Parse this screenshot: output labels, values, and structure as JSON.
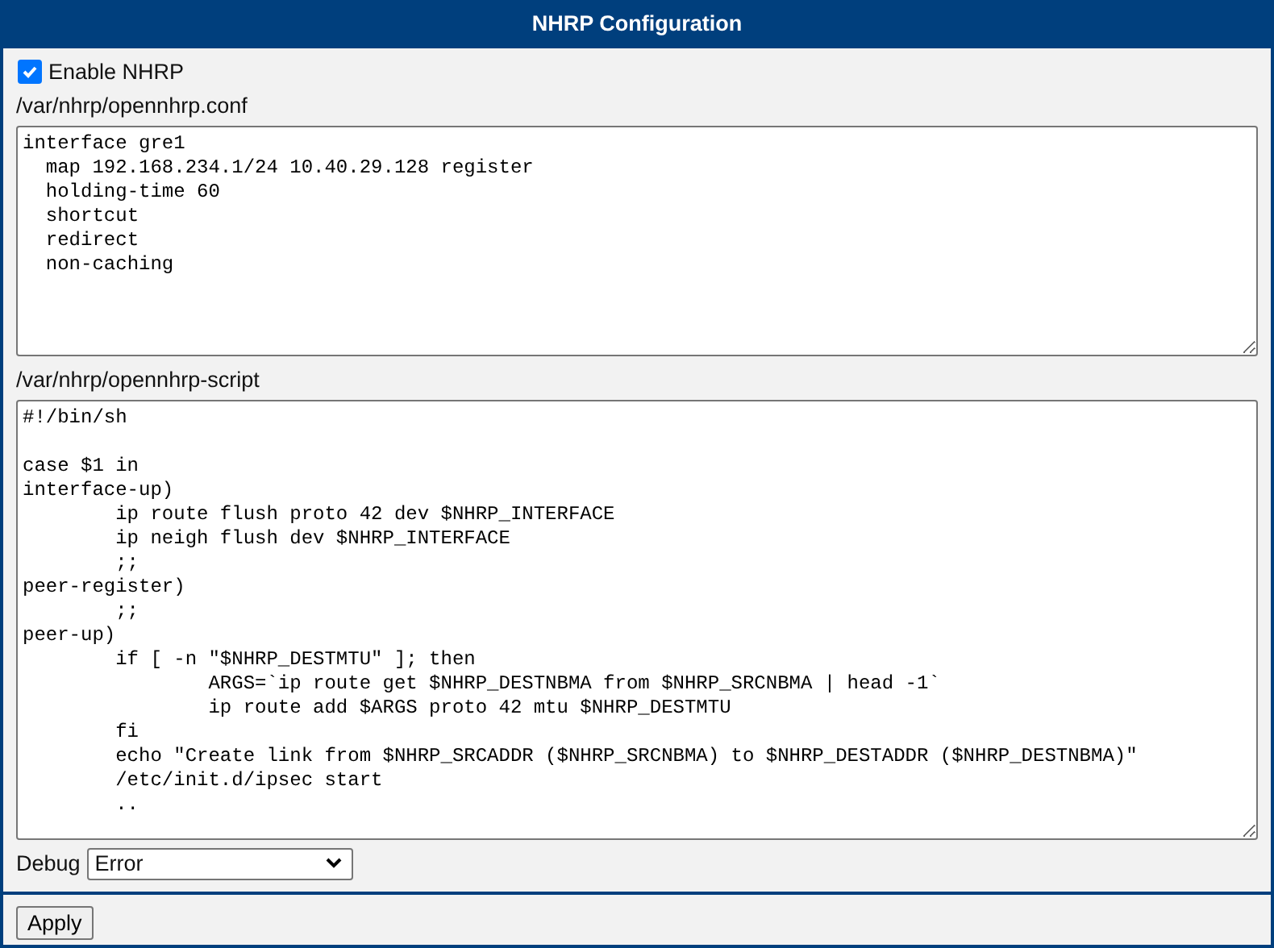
{
  "window": {
    "title": "NHRP Configuration"
  },
  "enable": {
    "label": "Enable NHRP",
    "checked": true
  },
  "config_file": {
    "label": "/var/nhrp/opennhrp.conf",
    "value": "interface gre1\n  map 192.168.234.1/24 10.40.29.128 register\n  holding-time 60\n  shortcut\n  redirect\n  non-caching"
  },
  "script_file": {
    "label": "/var/nhrp/opennhrp-script",
    "value": "#!/bin/sh\n\ncase $1 in\ninterface-up)\n\tip route flush proto 42 dev $NHRP_INTERFACE\n\tip neigh flush dev $NHRP_INTERFACE\n\t;;\npeer-register)\n\t;;\npeer-up)\n\tif [ -n \"$NHRP_DESTMTU\" ]; then\n\t\tARGS=`ip route get $NHRP_DESTNBMA from $NHRP_SRCNBMA | head -1`\n\t\tip route add $ARGS proto 42 mtu $NHRP_DESTMTU\n\tfi\n\techo \"Create link from $NHRP_SRCADDR ($NHRP_SRCNBMA) to $NHRP_DESTADDR ($NHRP_DESTNBMA)\"\n\t/etc/init.d/ipsec start\n\t.."
  },
  "debug": {
    "label": "Debug",
    "value": "Error"
  },
  "buttons": [
    "Apply"
  ]
}
